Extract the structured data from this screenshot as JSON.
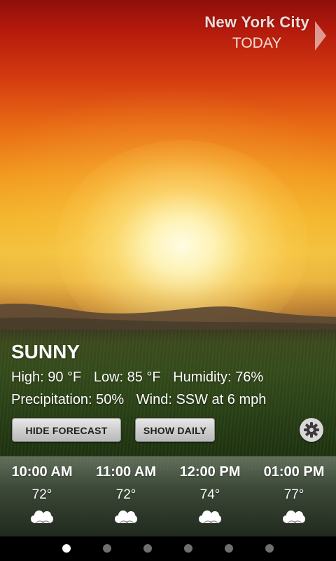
{
  "header": {
    "city": "New York City",
    "day": "TODAY"
  },
  "current": {
    "condition": "SUNNY",
    "high": "High: 90 °F",
    "low": "Low: 85 °F",
    "humidity": "Humidity: 76%",
    "precipitation": "Precipitation: 50%",
    "wind": "Wind: SSW at 6 mph"
  },
  "buttons": {
    "hide_forecast": "HIDE FORECAST",
    "show_daily": "SHOW DAILY",
    "settings_icon": "gear-icon"
  },
  "hourly": [
    {
      "time": "10:00 AM",
      "temp": "72°",
      "icon": "cloud-icon"
    },
    {
      "time": "11:00 AM",
      "temp": "72°",
      "icon": "cloud-icon"
    },
    {
      "time": "12:00 PM",
      "temp": "74°",
      "icon": "cloud-icon"
    },
    {
      "time": "01:00 PM",
      "temp": "77°",
      "icon": "cloud-icon"
    }
  ],
  "pager": {
    "page_count": 6,
    "active_page": 1
  },
  "colors": {
    "sky_top": "#8d0f0a",
    "sun": "#fff8d0",
    "button": "#cfcfcf"
  }
}
